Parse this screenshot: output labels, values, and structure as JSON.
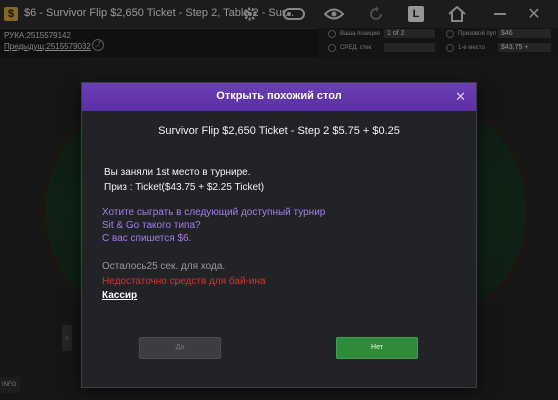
{
  "window": {
    "title": "$6 - Survivor Flip $2,650 Ticket - Step 2, Table 2 - Sur...",
    "l_label": "L"
  },
  "hand_info": {
    "hand": "РУКА:2515579142",
    "previous": "Предыдущ:2515579032"
  },
  "stats": {
    "your_position_label": "Ваша позиция",
    "your_position_value": "1 of 2",
    "prize_pool_label": "Призовой пул",
    "prize_pool_value": "$46",
    "avg_stack_label": "СРЕД. стек",
    "first_place_label": "1-е место",
    "first_place_value": "$43.75 +"
  },
  "table": {
    "info_tab": "INFO",
    "felt_color": "#0c5a25"
  },
  "dialog": {
    "title": "Открыть похожий стол",
    "tournament": "Survivor Flip $2,650 Ticket - Step 2 $5.75 + $0.25",
    "place": "Вы заняли 1st место в турнире.",
    "prize": "Приз : Ticket($43.75 + $2.25 Ticket)",
    "offer_line1": "Хотите сыграть в следующий доступный турнир",
    "offer_line2": "Sit & Go такого типа?",
    "offer_line3": "С вас спишется $6.",
    "remaining": "Осталось25 сек. для хода.",
    "insufficient": "Недостаточно средств для бай-ина",
    "cashier": "Кассир",
    "yes_button": "Да",
    "no_button": "Нет",
    "accent_color": "#6a3fb5"
  }
}
